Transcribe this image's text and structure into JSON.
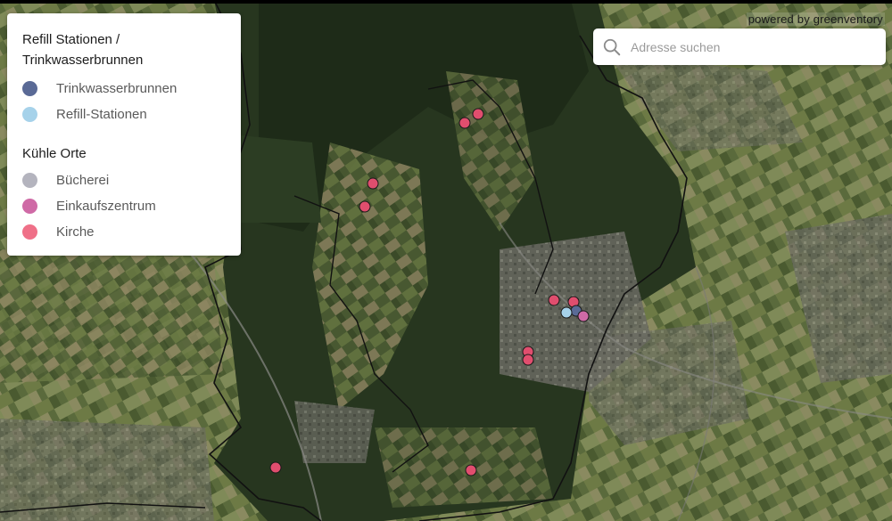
{
  "legend": {
    "group1_title": "Refill Stationen / Trinkwasserbrunnen",
    "group1_items": [
      {
        "label": "Trinkwasserbrunnen",
        "color": "#5a6a96"
      },
      {
        "label": "Refill-Stationen",
        "color": "#a6d2ea"
      }
    ],
    "group2_title": "Kühle Orte",
    "group2_items": [
      {
        "label": "Bücherei",
        "color": "#b4b4be"
      },
      {
        "label": "Einkaufszentrum",
        "color": "#cf6aa6"
      },
      {
        "label": "Kirche",
        "color": "#ef7088"
      }
    ]
  },
  "search": {
    "placeholder": "Adresse suchen",
    "value": ""
  },
  "credit": "powered by greenventory"
}
